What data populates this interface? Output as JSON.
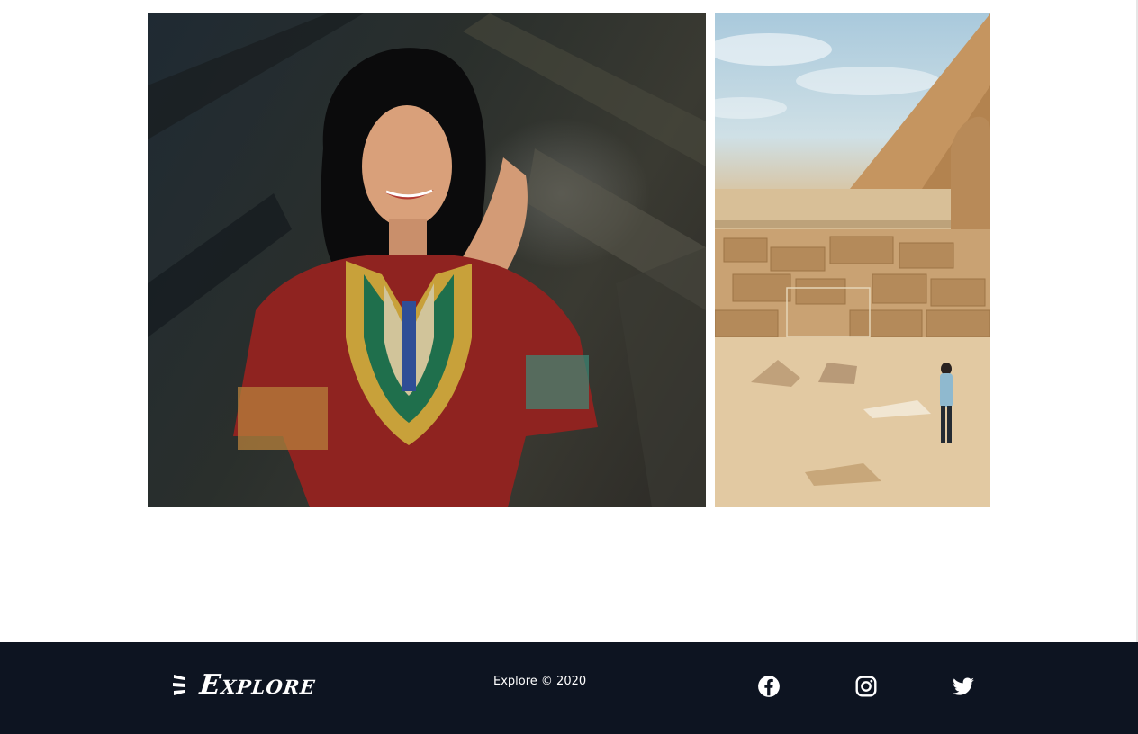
{
  "gallery": {
    "images": [
      {
        "subject": "woman in embroidered red dress smiling"
      },
      {
        "subject": "pyramid and sphinx with walking traveler"
      }
    ]
  },
  "footer": {
    "brand": "Explore",
    "copyright": "Explore © 2020",
    "social": [
      {
        "icon": "facebook-icon"
      },
      {
        "icon": "instagram-icon"
      },
      {
        "icon": "twitter-icon"
      }
    ],
    "colors": {
      "background": "#0d1421",
      "text": "#ffffff"
    }
  }
}
